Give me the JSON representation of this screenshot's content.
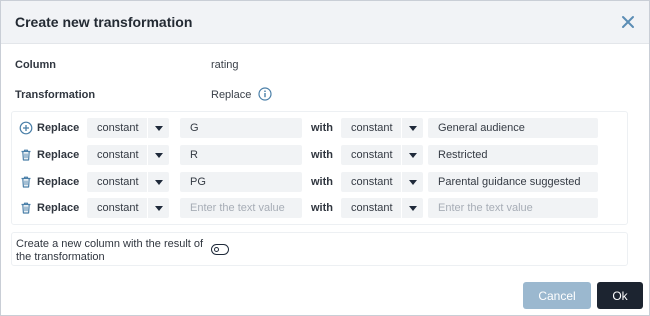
{
  "dialog": {
    "title": "Create new transformation",
    "close_icon": "close-icon"
  },
  "fields": {
    "column_label": "Column",
    "column_value": "rating",
    "transformation_label": "Transformation",
    "transformation_value": "Replace",
    "info_icon": "info-circle-icon"
  },
  "rules": [
    {
      "icon": "add-circle-icon",
      "label": "Replace",
      "from_type": "constant",
      "from_value": "G",
      "with_label": "with",
      "to_type": "constant",
      "to_value": "General audience",
      "from_placeholder": "",
      "to_placeholder": ""
    },
    {
      "icon": "trash-icon",
      "label": "Replace",
      "from_type": "constant",
      "from_value": "R",
      "with_label": "with",
      "to_type": "constant",
      "to_value": "Restricted",
      "from_placeholder": "",
      "to_placeholder": ""
    },
    {
      "icon": "trash-icon",
      "label": "Replace",
      "from_type": "constant",
      "from_value": "PG",
      "with_label": "with",
      "to_type": "constant",
      "to_value": "Parental guidance suggested",
      "from_placeholder": "",
      "to_placeholder": ""
    },
    {
      "icon": "trash-icon",
      "label": "Replace",
      "from_type": "constant",
      "from_value": "",
      "with_label": "with",
      "to_type": "constant",
      "to_value": "",
      "from_placeholder": "Enter the text value",
      "to_placeholder": "Enter the text value"
    }
  ],
  "new_column": {
    "text": "Create a new column with the result of the transformation",
    "toggle_on": false
  },
  "footer": {
    "cancel_label": "Cancel",
    "ok_label": "Ok"
  },
  "colors": {
    "header_bg": "#f1f3f6",
    "field_bg": "#f1f3f5",
    "accent": "#1c2430",
    "cancel_bg": "#9bb8cf",
    "icon": "#4a7fa8"
  }
}
